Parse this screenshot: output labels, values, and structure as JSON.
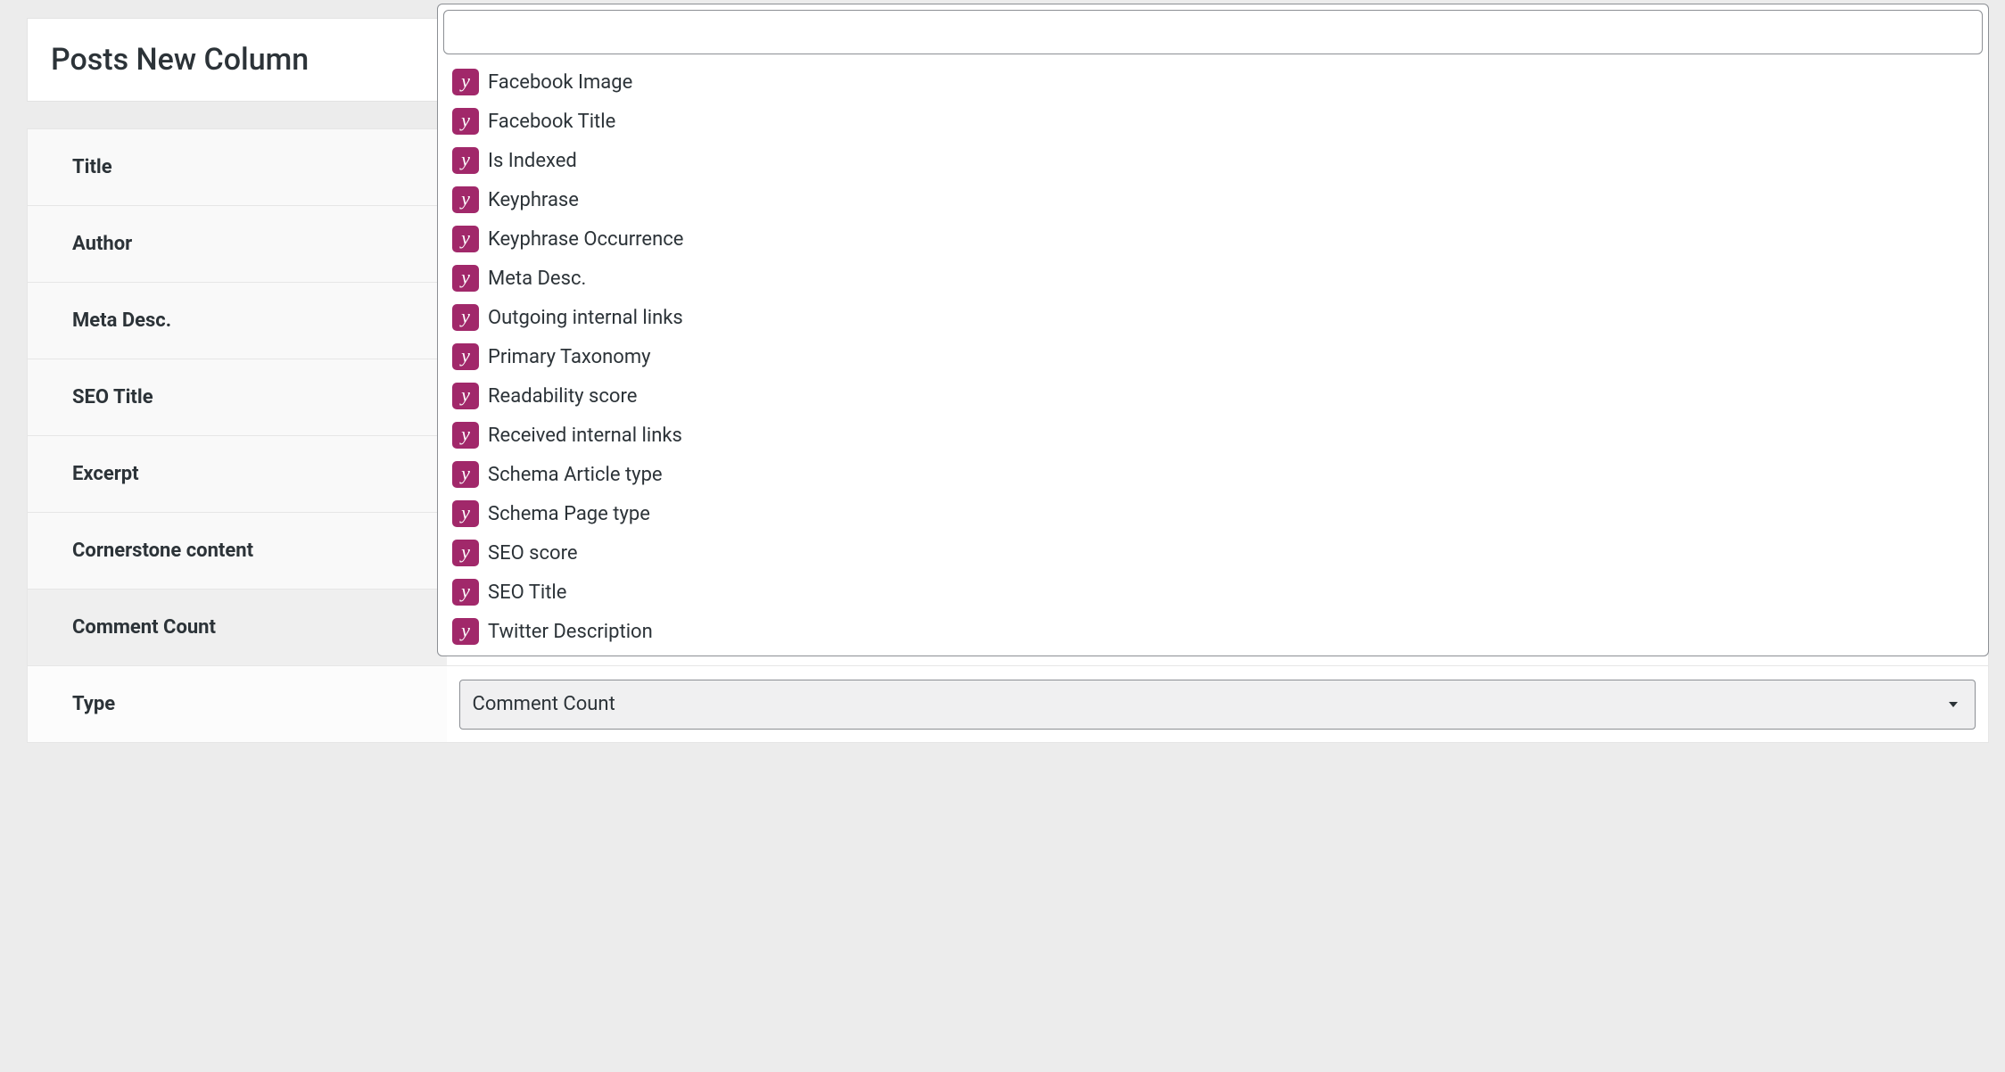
{
  "header": {
    "title": "Posts New Column"
  },
  "rows": [
    {
      "label": "Title"
    },
    {
      "label": "Author"
    },
    {
      "label": "Meta Desc."
    },
    {
      "label": "SEO Title"
    },
    {
      "label": "Excerpt"
    },
    {
      "label": "Cornerstone content"
    },
    {
      "label": "Comment Count"
    }
  ],
  "type_row": {
    "label": "Type",
    "selected": "Comment Count"
  },
  "dropdown": {
    "search": "",
    "items": [
      {
        "label": "Facebook Image"
      },
      {
        "label": "Facebook Title"
      },
      {
        "label": "Is Indexed"
      },
      {
        "label": "Keyphrase"
      },
      {
        "label": "Keyphrase Occurrence"
      },
      {
        "label": "Meta Desc."
      },
      {
        "label": "Outgoing internal links"
      },
      {
        "label": "Primary Taxonomy"
      },
      {
        "label": "Readability score"
      },
      {
        "label": "Received internal links"
      },
      {
        "label": "Schema Article type"
      },
      {
        "label": "Schema Page type"
      },
      {
        "label": "SEO score"
      },
      {
        "label": "SEO Title"
      },
      {
        "label": "Twitter Description"
      }
    ]
  },
  "colors": {
    "yoast": "#a1286a",
    "text": "#2c3338",
    "bg": "#ececec"
  }
}
